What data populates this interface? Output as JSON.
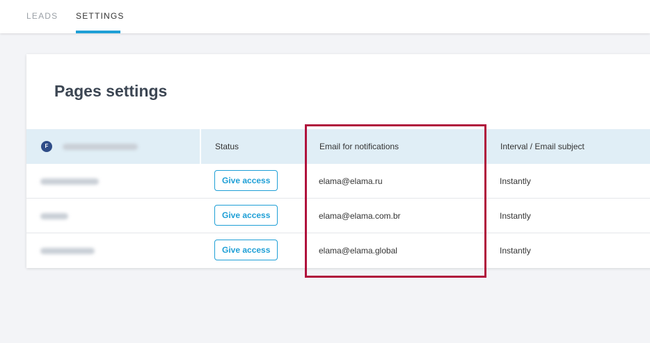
{
  "nav": {
    "tabs": [
      {
        "label": "LEADS",
        "active": false
      },
      {
        "label": "SETTINGS",
        "active": true
      }
    ]
  },
  "page": {
    "title": "Pages settings"
  },
  "table": {
    "columns": {
      "page": "",
      "status": "Status",
      "email": "Email for notifications",
      "interval": "Interval / Email subject"
    },
    "page_platform_icon": "F",
    "rows": [
      {
        "status_button": "Give access",
        "email": "elama@elama.ru",
        "interval": "Instantly"
      },
      {
        "status_button": "Give access",
        "email": "elama@elama.com.br",
        "interval": "Instantly"
      },
      {
        "status_button": "Give access",
        "email": "elama@elama.global",
        "interval": "Instantly"
      }
    ]
  },
  "colors": {
    "accent": "#1e9fd6",
    "header_bg": "#e0eef6",
    "highlight": "#b0123c",
    "facebook": "#2f4d88"
  }
}
